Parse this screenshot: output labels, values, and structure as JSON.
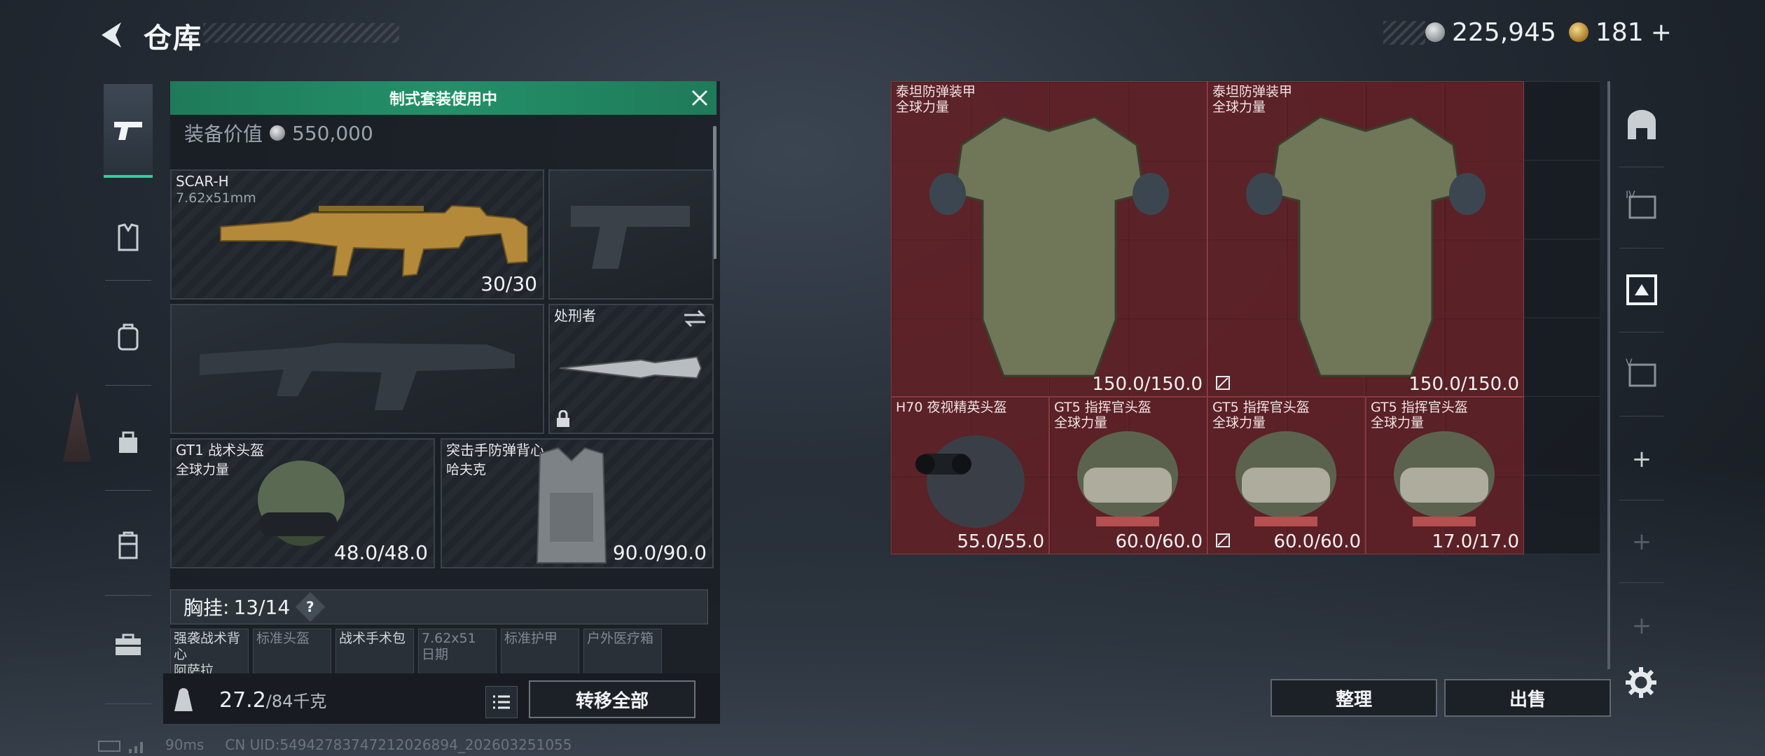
{
  "header": {
    "title": "仓库"
  },
  "currency": {
    "silver": "225,945",
    "gold": "181",
    "gold_add": "+"
  },
  "loadout": {
    "banner": "制式套装使用中",
    "equip_value_label": "装备价值",
    "equip_value": "550,000",
    "primary": {
      "name": "SCAR-H",
      "ammo_type": "7.62x51mm",
      "ammo": "30/30"
    },
    "melee": {
      "name": "处刑者"
    },
    "helmet": {
      "name": "GT1 战术头盔",
      "tag": "全球力量",
      "durability": "48.0/48.0"
    },
    "armor": {
      "name": "突击手防弹背心",
      "tag": "哈夫克",
      "durability": "90.0/90.0"
    },
    "chest_rig": {
      "label": "胸挂",
      "value": "13/14",
      "help": "?"
    },
    "rig_items": [
      {
        "label": "强袭战术背心",
        "sub": "阿萨拉"
      },
      {
        "label": "标准头盔",
        "sub": ""
      },
      {
        "label": "战术手术包",
        "sub": ""
      },
      {
        "label": "7.62x51",
        "sub": "日期"
      },
      {
        "label": "标准护甲",
        "sub": ""
      },
      {
        "label": "户外医疗箱",
        "sub": ""
      }
    ],
    "weight": {
      "current": "27.2",
      "max": "/84千克"
    },
    "transfer_all": "转移全部"
  },
  "storage": {
    "items": [
      {
        "name": "泰坦防弹装甲",
        "tag": "全球力量",
        "durability": "150.0/150.0",
        "locked": false
      },
      {
        "name": "泰坦防弹装甲",
        "tag": "全球力量",
        "durability": "150.0/150.0",
        "locked": true
      },
      {
        "name": "H70 夜视精英头盔",
        "tag": "",
        "durability": "55.0/55.0",
        "locked": false
      },
      {
        "name": "GT5 指挥官头盔",
        "tag": "全球力量",
        "durability": "60.0/60.0",
        "locked": false
      },
      {
        "name": "GT5 指挥官头盔",
        "tag": "全球力量",
        "durability": "60.0/60.0",
        "locked": true
      },
      {
        "name": "GT5 指挥官头盔",
        "tag": "全球力量",
        "durability": "17.0/17.0",
        "locked": false
      }
    ],
    "sort_button": "整理",
    "sell_button": "出售"
  },
  "footer": {
    "ping": "90ms",
    "uid": "CN UID:5494278374721202689​4_202603251055"
  },
  "icons": {
    "back": "back-arrow-icon",
    "pistol": "pistol-icon",
    "vest": "vest-icon",
    "backpack": "backpack-icon",
    "bag": "bag-icon",
    "case": "case-icon",
    "briefcase": "briefcase-icon",
    "settings": "gear-icon"
  },
  "colors": {
    "accent": "#23906a",
    "item_bg": "#742228",
    "panel": "#181c22"
  }
}
